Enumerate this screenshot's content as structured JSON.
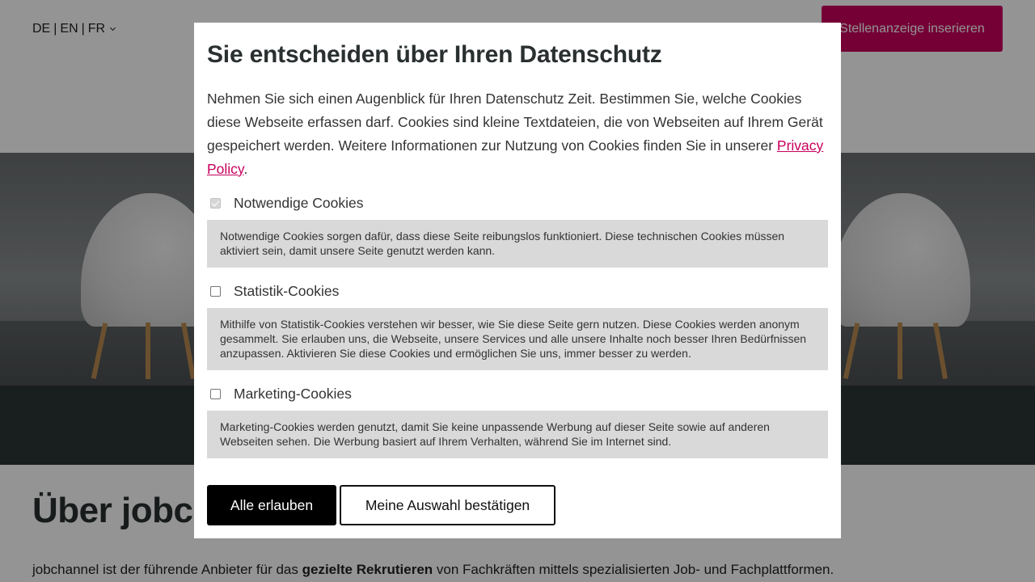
{
  "header": {
    "languages": [
      "DE",
      "EN",
      "FR"
    ],
    "separator": "|",
    "cta_label": "Stellenanzeige inserieren"
  },
  "content": {
    "title": "Über jobchannel",
    "text_before": "jobchannel ist der führende Anbieter für das ",
    "text_bold": "gezielte Rekrutieren",
    "text_after": " von Fachkräften mittels spezialisierten Job- und Fachplattformen."
  },
  "modal": {
    "title": "Sie entscheiden über Ihren Datenschutz",
    "intro": "Nehmen Sie sich einen Augenblick für Ihren Datenschutz Zeit. Bestimmen Sie, welche Cookies diese Webseite erfassen darf. Cookies sind kleine Textdateien, die von Webseiten auf Ihrem Gerät gespeichert werden. Weitere Informationen zur Nutzung von Cookies finden Sie in unserer ",
    "privacy_link": "Privacy Policy",
    "intro_end": ".",
    "options": [
      {
        "label": "Notwendige Cookies",
        "checked": true,
        "disabled": true,
        "description": "Notwendige Cookies sorgen dafür, dass diese Seite reibungslos funktioniert. Diese technischen Cookies müssen aktiviert sein, damit unsere Seite genutzt werden kann."
      },
      {
        "label": "Statistik-Cookies",
        "checked": false,
        "description": "Mithilfe von Statistik-Cookies verstehen wir besser, wie Sie diese Seite gern nutzen. Diese Cookies werden anonym gesammelt. Sie erlauben uns, die Webseite, unsere Services und alle unsere Inhalte noch besser Ihren Bedürfnissen anzupassen. Aktivieren Sie diese Cookies und ermöglichen Sie uns, immer besser zu werden."
      },
      {
        "label": "Marketing-Cookies",
        "checked": false,
        "description": "Marketing-Cookies werden genutzt, damit Sie keine unpassende Werbung auf dieser Seite sowie auf anderen Webseiten sehen. Die Werbung basiert auf Ihrem Verhalten, während Sie im Internet sind."
      }
    ],
    "allow_all_label": "Alle erlauben",
    "confirm_label": "Meine Auswahl bestätigen"
  },
  "colors": {
    "brand": "#c8005d",
    "dark": "#2b3536",
    "overlay": "rgba(0,0,0,0.42)"
  }
}
